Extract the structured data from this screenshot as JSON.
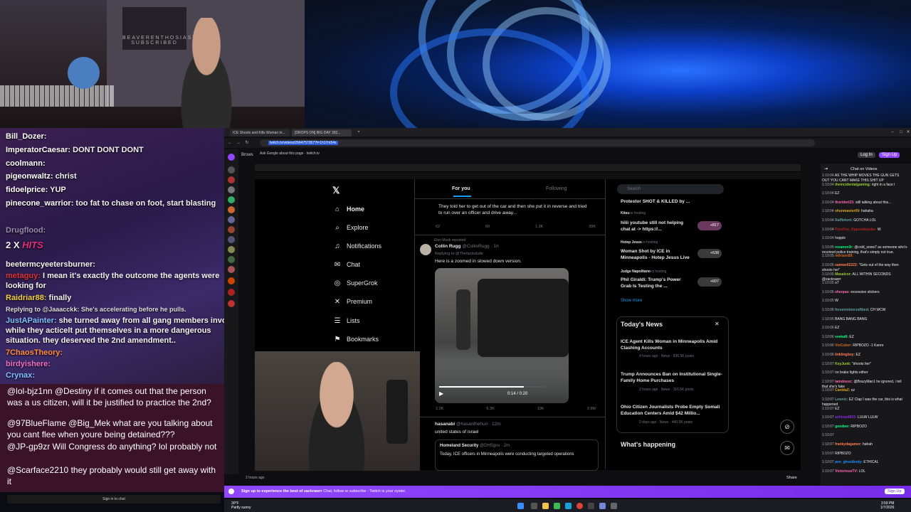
{
  "webcam": {
    "poster_text": "BEAVERENTHOSIAST SUBSCRIBED"
  },
  "overlay_chat": [
    {
      "user": "Bill_Dozer:",
      "msg": ""
    },
    {
      "user": "ImperatorCaesar:",
      "msg": "DONT DONT DONT"
    },
    {
      "user": "coolmann:",
      "msg": ""
    },
    {
      "user": "pigeonwaltz:",
      "msg": "christ"
    },
    {
      "user": "fidoelprice:",
      "msg": "YUP"
    },
    {
      "user": "pinecone_warrior:",
      "msg": "too fat to chase on foot, start blasting"
    },
    {
      "user": "Drugflood:",
      "msg": ""
    },
    {
      "user": "2 X",
      "msg": "HITS"
    },
    {
      "user": "beetermcyeetersburner:",
      "msg": ""
    },
    {
      "user": "metaguy:",
      "msg": "I mean it's exactly the outcome the agents were"
    },
    {
      "user": "",
      "msg": "looking for"
    },
    {
      "user": "Raidriar88:",
      "msg": "finally"
    },
    {
      "user": "",
      "msg": "Replying to @Jaaacckk: She's accelerating before he pulls."
    },
    {
      "user": "JustAPainter:",
      "msg": "she turned away from all gang members involved"
    },
    {
      "user": "",
      "msg": "while they acticelt put themselves in a more dangerous"
    },
    {
      "user": "",
      "msg": "situation. they deserved the 2nd amendment.."
    },
    {
      "user": "7ChaosTheory:",
      "msg": ""
    },
    {
      "user": "birdyishere:",
      "msg": ""
    },
    {
      "user": "Crynax:",
      "msg": ""
    }
  ],
  "donations": [
    "@lol-bjz1nn @Destiny if it comes out that the person was a us citizen, will it be justified to practice the 2nd?",
    "@97BlueFlame @Big_Mek what are you talking about you cant flee when youre being detained???",
    "@JP-gp9zr Will Congress do anything? lol probably not",
    "@Scarface2210 they probably would still get away with it"
  ],
  "sign_in_chat": "Sign in to chat",
  "browser": {
    "tabs": [
      "ICE Shoots and Kills Woman in...",
      "[DROPS ON] BIG DAY 382..."
    ],
    "url": "twitch.tv/videos/2664757357?t=1h17m54s",
    "suggest": "Ask Google about this page · twitch.tv",
    "browse_label": "Brows",
    "login": "Log In",
    "signup": "Sign Up",
    "chat_header": "Chat on Videos",
    "time_ago": "2 hours ago",
    "share": "Share"
  },
  "x": {
    "nav": [
      "Home",
      "Explore",
      "Notifications",
      "Chat",
      "SuperGrok",
      "Premium",
      "Lists",
      "Bookmarks"
    ],
    "tab_foryou": "For you",
    "tab_following": "Following",
    "tweet1_text": "They told her to get out of the car and then she put it in reverse and tried to run over an officer and drive away...",
    "tweet1_stats": [
      "62",
      "60",
      "1.3K",
      "39K"
    ],
    "repost_by": "Elon Musk reposted",
    "tweet2_author": "Collin Rugg",
    "tweet2_handle": "@CollinRugg · 1h",
    "tweet2_reply": "Replying to @Thefactsdude",
    "tweet2_text": "Here is a zoomed in slowed down version.",
    "video_time": "0:14 / 0:20",
    "tweet2_stats": [
      "2.2K",
      "6.3K",
      "19K",
      "3.9M"
    ],
    "tweet3_author": "hasanabi",
    "tweet3_handle": "@hasanthehun · 12m",
    "tweet3_text": "united states of israel",
    "quote_author": "Homeland Security",
    "quote_handle": "@DHSgov · 2m",
    "quote_text": "Today, ICE officers in Minneapolis were conducting targeted operations",
    "search": "Search",
    "live_top": "Protestor SHOT & KILLED by ...",
    "live": [
      {
        "host": "Kitsu",
        "tag": "is hosting",
        "title": "hiiii youtube still not helping chat at -> https://...",
        "count": "+817"
      },
      {
        "host": "Hotep Jesus",
        "tag": "is hosting",
        "title": "Woman Shot by ICE in Minneapolis - Hotep Jesus Live",
        "count": "+638"
      },
      {
        "host": "Judge Napolitano",
        "tag": "is hosting",
        "title": "Phil Giraldi: Trump's Power Grab Is Testing the ...",
        "count": "+607"
      }
    ],
    "show_more": "Show more",
    "news_header": "Today's News",
    "news": [
      {
        "title": "ICE Agent Kills Woman in Minneapolis Amid Clashing Accounts",
        "meta": "4 hours ago · News · 836.5K posts"
      },
      {
        "title": "Trump Announces Ban on Institutional Single-Family Home Purchases",
        "meta": "2 hours ago · News · 116.5K posts"
      },
      {
        "title": "Ohio Citizen Journalists Probe Empty Somali Education Centers Amid $42 Millio...",
        "meta": "2 days ago · News · 440.5K posts"
      }
    ],
    "whats_happening": "What's happening"
  },
  "right_chat": [
    {
      "t": "1:10:04",
      "u": "",
      "m": "AS THE WHIP MOVES THE GUN GETS OUT YOU CANT MAKE THIS SHIT UP"
    },
    {
      "t": "1:10:04",
      "u": "theincidentalgaming:",
      "m": "right in a face l"
    },
    {
      "t": "1:10:04",
      "u": "",
      "m": "EZ"
    },
    {
      "t": "1:10:04",
      "u": "fireriderl23:",
      "m": "still talking about this..."
    },
    {
      "t": "1:10:04",
      "u": "shunmaster09:",
      "m": "hahaha"
    },
    {
      "t": "1:10:04",
      "u": "Rafflelunt:",
      "m": "GOTCHA LOL"
    },
    {
      "t": "1:10:04",
      "u": "PyroFox_Oppositepolar:",
      "m": "W"
    },
    {
      "t": "1:10:04",
      "u": "",
      "m": "hopple"
    },
    {
      "t": "1:10:05",
      "u": "revanon3r:",
      "m": "@cold_snow7 as someone who's received police training, that's simply not true."
    },
    {
      "t": "1:10:05",
      "u": "m0rtaro89:",
      "m": ""
    },
    {
      "t": "1:10:05",
      "u": "samwell2222:",
      "m": "\"Gets out of the way then shoots her\""
    },
    {
      "t": "1:10:05",
      "u": "Masalcor:",
      "m": "ALL WITHIN SECONDS @zackrawrr"
    },
    {
      "t": "1:10:05",
      "u": "",
      "m": "o7"
    },
    {
      "t": "1:10:05",
      "u": "sherpas:",
      "m": "excessive stickers"
    },
    {
      "t": "1:10:05",
      "u": "",
      "m": "W"
    },
    {
      "t": "1:10:06",
      "u": "forsenminecraftbed:",
      "m": "CH WCW"
    },
    {
      "t": "1:10:06",
      "u": "",
      "m": "BANG BANG BANG"
    },
    {
      "t": "1:10:06",
      "u": "",
      "m": "EZ"
    },
    {
      "t": "1:10:06",
      "u": "vvekaft:",
      "m": "EZ"
    },
    {
      "t": "1:10:06",
      "u": "VioCuber:",
      "m": "RIPBOZO -1 Karen"
    },
    {
      "t": "1:10:06",
      "u": "linklingboy:",
      "m": "EZ"
    },
    {
      "t": "1:10:07",
      "u": "KeyJunk:",
      "m": "\"shoots her\""
    },
    {
      "t": "1:10:07",
      "u": "",
      "m": "no brake lights either"
    },
    {
      "t": "1:10:07",
      "u": "lamdosoc:",
      "m": "@BrazyMan1 he ignored, i tell that she's fake"
    },
    {
      "t": "1:10:07",
      "u": "CanldaZ:",
      "m": "ez"
    },
    {
      "t": "1:10:07",
      "u": "Lewvic:",
      "m": "EZ Clap I was the car, this is what happened"
    },
    {
      "t": "1:10:07",
      "u": "",
      "m": "EZ"
    },
    {
      "t": "1:10:07",
      "u": "ashtray4815:",
      "m": "LULW LULW"
    },
    {
      "t": "1:10:07",
      "u": "goodwo:",
      "m": "RIPBOZO"
    },
    {
      "t": "1:10:07",
      "u": "",
      "m": ""
    },
    {
      "t": "1:10:07",
      "u": "frankydagamer:",
      "m": "hahah"
    },
    {
      "t": "1:10:07",
      "u": "",
      "m": "RIPBOZO"
    },
    {
      "t": "1:10:07",
      "u": "pen_ghostbody:",
      "m": "ETHICAL"
    },
    {
      "t": "1:10:07",
      "u": "VictoriousTV:",
      "m": "LOL"
    }
  ],
  "signup_bar": {
    "text": "Sign up to experience the best of zackrawrr",
    "sub": "Chat, follow or subscribe - Twitch is your oyster.",
    "button": "Sign Up"
  },
  "taskbar": {
    "weather_temp": "30°F",
    "weather_desc": "Partly sunny",
    "time": "3:59 PM",
    "date": "1/7/2026"
  }
}
